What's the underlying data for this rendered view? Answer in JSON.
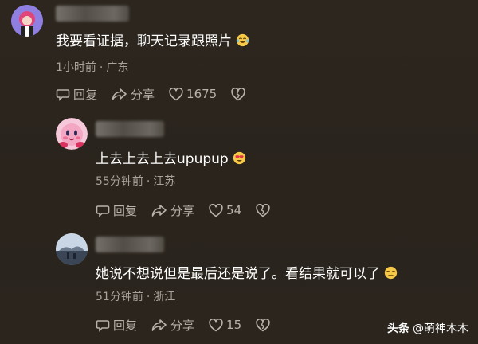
{
  "comments": [
    {
      "text": "我要看证据，聊天记录跟照片",
      "emoji": "crying-laughing-emoji",
      "time": "1小时前",
      "location": "广东",
      "reply_label": "回复",
      "share_label": "分享",
      "likes": "1675"
    },
    {
      "text": "上去上去上去upupup",
      "emoji": "heart-eyes-emoji",
      "time": "55分钟前",
      "location": "江苏",
      "reply_label": "回复",
      "share_label": "分享",
      "likes": "54"
    },
    {
      "text": "她说不想说但是最后还是说了。看结果就可以了",
      "emoji": "unamused-emoji",
      "time": "51分钟前",
      "location": "浙江",
      "reply_label": "回复",
      "share_label": "分享",
      "likes": "15"
    }
  ],
  "meta_separator": "·",
  "watermark": {
    "brand": "头条",
    "handle": "@萌神木木"
  },
  "colors": {
    "background": "#2a241d",
    "text": "#ffffff",
    "meta": "#a8a29a",
    "action": "#b8b2aa"
  }
}
